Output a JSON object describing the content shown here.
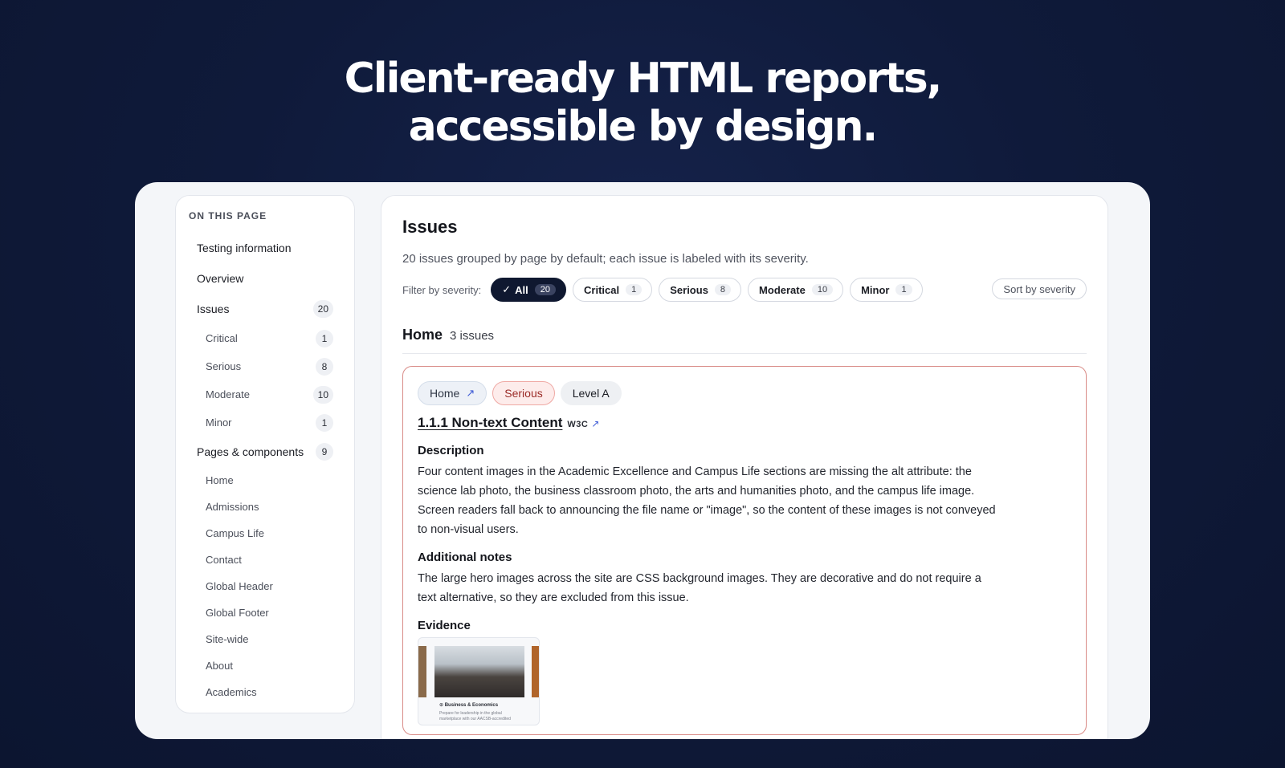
{
  "hero": {
    "line1": "Client-ready HTML reports,",
    "line2": "accessible by design."
  },
  "toc": {
    "heading": "ON THIS PAGE",
    "items": [
      {
        "label": "Testing information"
      },
      {
        "label": "Overview"
      },
      {
        "label": "Issues",
        "count": "20"
      }
    ],
    "severities": [
      {
        "label": "Critical",
        "count": "1"
      },
      {
        "label": "Serious",
        "count": "8"
      },
      {
        "label": "Moderate",
        "count": "10"
      },
      {
        "label": "Minor",
        "count": "1"
      }
    ],
    "pages_label": "Pages & components",
    "pages_count": "9",
    "pages": [
      "Home",
      "Admissions",
      "Campus Life",
      "Contact",
      "Global Header",
      "Global Footer",
      "Site-wide",
      "About",
      "Academics"
    ]
  },
  "main": {
    "title": "Issues",
    "intro": "20 issues grouped by page by default; each issue is labeled with its severity.",
    "filter_label": "Filter by severity:",
    "filters": [
      {
        "label": "All",
        "count": "20",
        "check": "✓"
      },
      {
        "label": "Critical",
        "count": "1"
      },
      {
        "label": "Serious",
        "count": "8"
      },
      {
        "label": "Moderate",
        "count": "10"
      },
      {
        "label": "Minor",
        "count": "1"
      }
    ],
    "sort_label": "Sort by severity",
    "section": {
      "title": "Home",
      "count": "3 issues"
    },
    "issue": {
      "tag_page": "Home",
      "tag_page_arrow": "↗",
      "tag_severity": "Serious",
      "tag_level": "Level A",
      "criterion": "1.1.1 Non-text Content",
      "w3c": "W3C",
      "w3c_arrow": "↗",
      "description_label": "Description",
      "description": "Four content images in the Academic Excellence and Campus Life sections are missing the alt attribute: the science lab photo, the business classroom photo, the arts and humanities photo, and the campus life image. Screen readers fall back to announcing the file name or \"image\", so the content of these images is not conveyed to non-visual users.",
      "notes_label": "Additional notes",
      "notes": "The large hero images across the site are CSS background images. They are decorative and do not require a text alternative, so they are excluded from this issue.",
      "evidence_label": "Evidence",
      "evidence_caption": "⊙ Business & Economics",
      "evidence_sub": "Prepare for leadership in the global marketplace with our AACSB-accredited"
    }
  },
  "colors": {
    "background": "#0f1a3a",
    "filter_active": "#0f1830",
    "serious_border": "#d98b87",
    "serious_text": "#9b2c28",
    "link_arrow": "#3d5bd6"
  }
}
